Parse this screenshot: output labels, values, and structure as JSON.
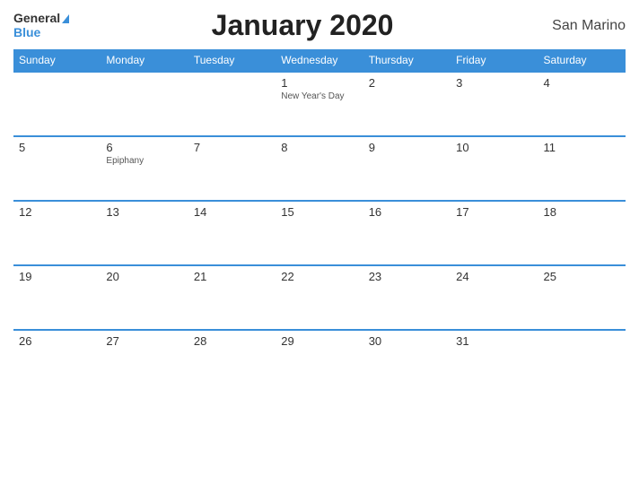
{
  "header": {
    "title": "January 2020",
    "country": "San Marino",
    "logo_general": "General",
    "logo_blue": "Blue"
  },
  "days_of_week": [
    "Sunday",
    "Monday",
    "Tuesday",
    "Wednesday",
    "Thursday",
    "Friday",
    "Saturday"
  ],
  "weeks": [
    [
      {
        "date": "",
        "holiday": ""
      },
      {
        "date": "",
        "holiday": ""
      },
      {
        "date": "",
        "holiday": ""
      },
      {
        "date": "1",
        "holiday": "New Year's Day"
      },
      {
        "date": "2",
        "holiday": ""
      },
      {
        "date": "3",
        "holiday": ""
      },
      {
        "date": "4",
        "holiday": ""
      }
    ],
    [
      {
        "date": "5",
        "holiday": ""
      },
      {
        "date": "6",
        "holiday": "Epiphany"
      },
      {
        "date": "7",
        "holiday": ""
      },
      {
        "date": "8",
        "holiday": ""
      },
      {
        "date": "9",
        "holiday": ""
      },
      {
        "date": "10",
        "holiday": ""
      },
      {
        "date": "11",
        "holiday": ""
      }
    ],
    [
      {
        "date": "12",
        "holiday": ""
      },
      {
        "date": "13",
        "holiday": ""
      },
      {
        "date": "14",
        "holiday": ""
      },
      {
        "date": "15",
        "holiday": ""
      },
      {
        "date": "16",
        "holiday": ""
      },
      {
        "date": "17",
        "holiday": ""
      },
      {
        "date": "18",
        "holiday": ""
      }
    ],
    [
      {
        "date": "19",
        "holiday": ""
      },
      {
        "date": "20",
        "holiday": ""
      },
      {
        "date": "21",
        "holiday": ""
      },
      {
        "date": "22",
        "holiday": ""
      },
      {
        "date": "23",
        "holiday": ""
      },
      {
        "date": "24",
        "holiday": ""
      },
      {
        "date": "25",
        "holiday": ""
      }
    ],
    [
      {
        "date": "26",
        "holiday": ""
      },
      {
        "date": "27",
        "holiday": ""
      },
      {
        "date": "28",
        "holiday": ""
      },
      {
        "date": "29",
        "holiday": ""
      },
      {
        "date": "30",
        "holiday": ""
      },
      {
        "date": "31",
        "holiday": ""
      },
      {
        "date": "",
        "holiday": ""
      }
    ]
  ]
}
